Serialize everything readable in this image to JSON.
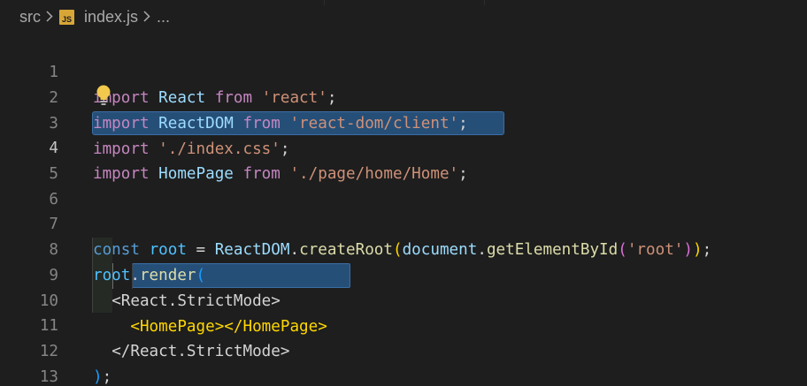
{
  "breadcrumb": {
    "folder": "src",
    "file_icon": "js-file-icon",
    "file_icon_text": "JS",
    "file": "index.js",
    "more": "..."
  },
  "gutter": {
    "line_numbers": [
      "1",
      "2",
      "3",
      "4",
      "5",
      "6",
      "7",
      "8",
      "9",
      "10",
      "11",
      "12",
      "13"
    ],
    "active_line": "4"
  },
  "code": {
    "l1": {
      "t1": "import",
      "t2": "React",
      "t3": "from",
      "t4": "'react'",
      "t5": ";"
    },
    "l2": {
      "t1": "import",
      "t2": "ReactDOM",
      "t3": "from",
      "t4": "'react-dom/client'",
      "t5": ";"
    },
    "l3": {
      "t1": "import",
      "t2": "'./index.css'",
      "t3": ";"
    },
    "l4": {
      "t1": "import",
      "t2": "HomePage",
      "t3": "from",
      "t4": "'./page/home/Home'",
      "t5": ";"
    },
    "l7": {
      "t1": "const",
      "t2": "root",
      "t3": " = ",
      "t4": "ReactDOM",
      "t5": ".",
      "t6": "createRoot",
      "t7": "(",
      "t8": "document",
      "t9": ".",
      "t10": "getElementById",
      "t11": "(",
      "t12": "'root'",
      "t13": ")",
      "t14": ")",
      "t15": ";"
    },
    "l8": {
      "t1": "root",
      "t2": ".",
      "t3": "render",
      "t4": "("
    },
    "l9": {
      "t1": "<",
      "t2": "React.StrictMode",
      "t3": ">"
    },
    "l10": {
      "t1": "<",
      "t2": "HomePage",
      "t3": "></",
      "t4": "HomePage",
      "t5": ">"
    },
    "l11": {
      "t1": "</",
      "t2": "React.StrictMode",
      "t3": ">"
    },
    "l12": {
      "t1": ")",
      "t2": ";"
    }
  },
  "icons": {
    "lightbulb": "lightbulb-icon",
    "chevron": "chevron-right-icon"
  },
  "colors": {
    "background": "#1e1e1e",
    "selection": "#264f78",
    "keyword": "#c586c0",
    "string": "#ce9178",
    "variable": "#9cdcfe",
    "function": "#dcdcaa",
    "tag": "#4ec9b0",
    "lightbulb": "#f2c94c"
  }
}
